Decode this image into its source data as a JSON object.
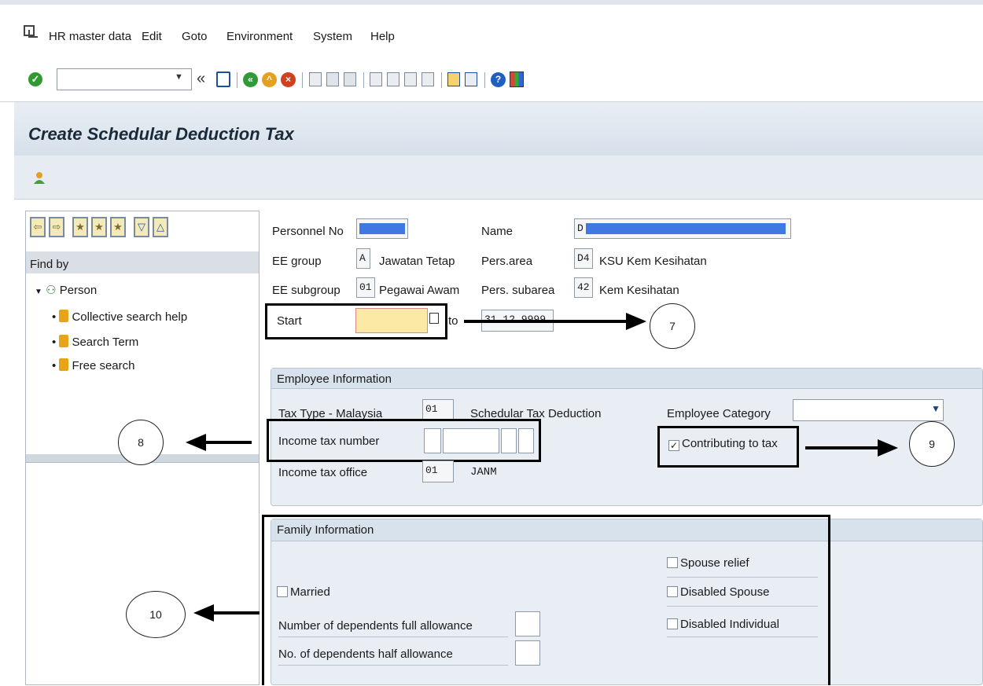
{
  "menu": {
    "items": [
      "HR master data",
      "Edit",
      "Goto",
      "Environment",
      "System",
      "Help"
    ]
  },
  "toolbar": {
    "command_value": "",
    "back_glyph": "«"
  },
  "page": {
    "title": "Create Schedular Deduction Tax"
  },
  "left_pane": {
    "find_by": "Find by",
    "person": "Person",
    "items": [
      "Collective search help",
      "Search Term",
      "Free search"
    ]
  },
  "header": {
    "personnel_no_label": "Personnel No",
    "name_label": "Name",
    "name_prefix": "D",
    "ee_group_label": "EE group",
    "ee_group_code": "A",
    "ee_group_text": "Jawatan Tetap",
    "pers_area_label": "Pers.area",
    "pers_area_code": "D4",
    "pers_area_text": "KSU Kem Kesihatan",
    "ee_subgroup_label": "EE subgroup",
    "ee_subgroup_code": "01",
    "ee_subgroup_text": "Pegawai Awam",
    "pers_subarea_label": "Pers. subarea",
    "pers_subarea_code": "42",
    "pers_subarea_text": "Kem Kesihatan",
    "start_label": "Start",
    "start_value": "",
    "to_label": "to",
    "end_value": "31.12.9999"
  },
  "employee_info": {
    "title": "Employee Information",
    "tax_type_label": "Tax Type - Malaysia",
    "tax_type_code": "01",
    "tax_type_text": "Schedular Tax Deduction",
    "employee_category_label": "Employee Category",
    "employee_category_value": "",
    "income_tax_number_label": "Income tax number",
    "contributing_label": "Contributing to tax",
    "contributing_checked": true,
    "income_tax_office_label": "Income tax office",
    "income_tax_office_code": "01",
    "income_tax_office_text": "JANM"
  },
  "family_info": {
    "title": "Family Information",
    "spouse_relief": "Spouse relief",
    "married": "Married",
    "disabled_spouse": "Disabled Spouse",
    "full_allowance_label": "Number of dependents full allowance",
    "disabled_individual": "Disabled Individual",
    "half_allowance_label": "No. of dependents half allowance"
  },
  "callouts": {
    "c7": "7",
    "c8": "8",
    "c9": "9",
    "c10": "10"
  }
}
